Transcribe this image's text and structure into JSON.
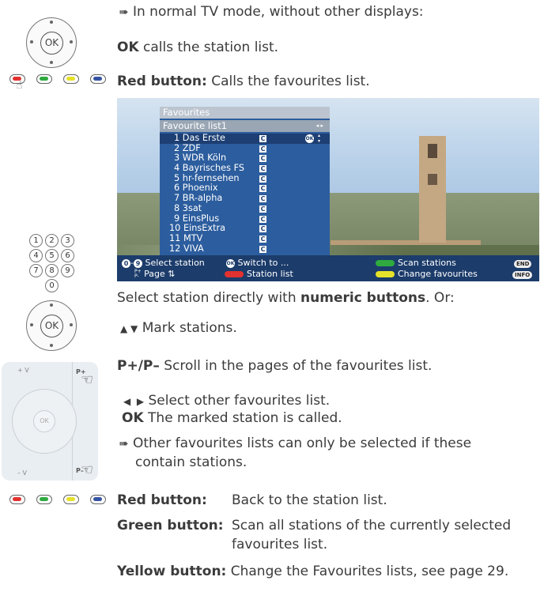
{
  "intro": {
    "line1": "In normal TV mode, without other displays:",
    "ok_key": "OK",
    "ok_text": "calls the station list."
  },
  "red_intro": {
    "label": "Red button:",
    "text": "Calls the favourites list."
  },
  "tv_screen": {
    "panel_title": "Favourites",
    "list_name": "Favourite list1",
    "stations": [
      "1 Das Erste",
      "2 ZDF",
      "3 WDR Köln",
      "4 Bayrisches FS",
      "5 hr-fernsehen",
      "6 Phoenix",
      "7 BR-alpha",
      "8 3sat",
      "9 EinsPlus",
      "10 EinsExtra",
      "11 MTV",
      "12 VIVA"
    ],
    "station_marker": "C",
    "bar": {
      "select_station": "Select station",
      "page": "Page",
      "switch_to": "Switch to ...",
      "station_list": "Station list",
      "scan_stations": "Scan stations",
      "change_favourites": "Change favourites",
      "end_key": "END",
      "info_key": "INFO",
      "key_0": "0",
      "key_9": "9",
      "key_ok": "OK"
    }
  },
  "body": {
    "numeric_pre": "Select station directly with",
    "numeric_bold": "numeric buttons",
    "numeric_post": ". Or:",
    "mark": "Mark stations.",
    "pp_key": "P+/P–",
    "pp_text": "Scroll in the pages of the favourites list.",
    "lr_text": "Select other favourites list.",
    "ok_key": "OK",
    "ok_text": "The marked station is called.",
    "note_line1": "Other favourites lists can only be selected if these",
    "note_line2": "contain stations."
  },
  "buttons": [
    {
      "label": "Red button:",
      "text": "Back to the station list."
    },
    {
      "label": "Green button:",
      "text": "Scan all stations of the currently selected",
      "text2": "favourites list."
    },
    {
      "label": "Yellow button:",
      "text": "Change the Favourites lists, see page 29."
    }
  ],
  "colors": {
    "red": "#e2312f",
    "green": "#2faa3f",
    "yellow": "#e6e22a",
    "blue": "#3653a3",
    "panel": "#2c5d9e"
  },
  "keypad": [
    "1",
    "2",
    "3",
    "4",
    "5",
    "6",
    "7",
    "8",
    "9",
    "0"
  ]
}
